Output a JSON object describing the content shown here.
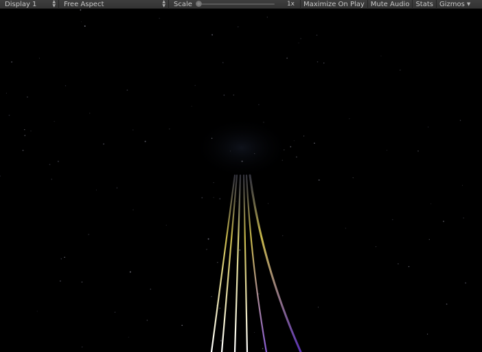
{
  "toolbar": {
    "display_label": "Display 1",
    "aspect_label": "Free Aspect",
    "scale_label": "Scale",
    "scale_value": "1x",
    "scale_fraction": 0,
    "maximize_label": "Maximize On Play",
    "mute_label": "Mute Audio",
    "stats_label": "Stats",
    "gizmos_label": "Gizmos"
  },
  "scene": {
    "background_color": "#000000",
    "stream_colors": [
      "#c8b84a",
      "#d8d078",
      "#ffffff",
      "#8a5cd6",
      "#5a32b4"
    ]
  }
}
